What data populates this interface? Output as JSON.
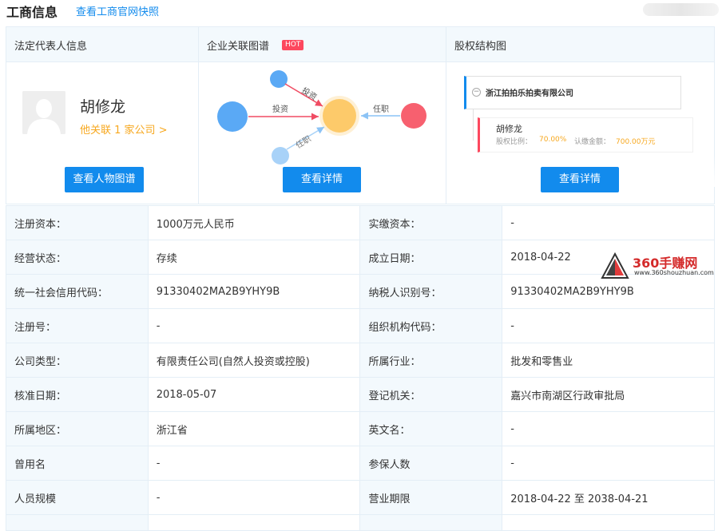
{
  "header": {
    "title": "工商信息",
    "link": "查看工商官网快照"
  },
  "panels": {
    "legal_rep": {
      "heading": "法定代表人信息",
      "name": "胡修龙",
      "relation": "他关联 1 家公司 >",
      "button": "查看人物图谱"
    },
    "graph": {
      "heading": "企业关联图谱",
      "badge": "HOT",
      "edge_labels": [
        "投资",
        "投资",
        "任职",
        "任职"
      ],
      "button": "查看详情",
      "colors": {
        "node_blue": "#5aa9f5",
        "node_center": "#fdca6a",
        "node_red": "#f7606f"
      }
    },
    "equity": {
      "heading": "股权结构图",
      "company": "浙江拍拍乐拍卖有限公司",
      "shareholder": "胡修龙",
      "ratio_label": "股权比例：",
      "ratio_value": "70.00%",
      "sub_label": "认缴金额：",
      "sub_value": "700.00万元",
      "button": "查看详情"
    }
  },
  "table": {
    "rows": [
      [
        "注册资本：",
        "1000万元人民币",
        "实缴资本：",
        "-"
      ],
      [
        "经营状态：",
        "存续",
        "成立日期：",
        "2018-04-22"
      ],
      [
        "统一社会信用代码：",
        "91330402MA2B9YHY9B",
        "纳税人识别号：",
        "91330402MA2B9YHY9B"
      ],
      [
        "注册号：",
        "-",
        "组织机构代码：",
        "-"
      ],
      [
        "公司类型：",
        "有限责任公司(自然人投资或控股)",
        "所属行业：",
        "批发和零售业"
      ],
      [
        "核准日期：",
        "2018-05-07",
        "登记机关：",
        "嘉兴市南湖区行政审批局"
      ],
      [
        "所属地区：",
        "浙江省",
        "英文名：",
        "-"
      ],
      [
        "曾用名",
        "-",
        "参保人数",
        "-"
      ],
      [
        "人员规模",
        "-",
        "营业期限",
        "2018-04-22 至 2038-04-21"
      ]
    ]
  },
  "watermark": {
    "brand": "360手赚网",
    "url": "www.360shouzhuan.com"
  },
  "colors": {
    "accent": "#128bed",
    "orange": "#f7a81f",
    "hot": "#fd485e",
    "key_bg": "#f3f9fd"
  }
}
